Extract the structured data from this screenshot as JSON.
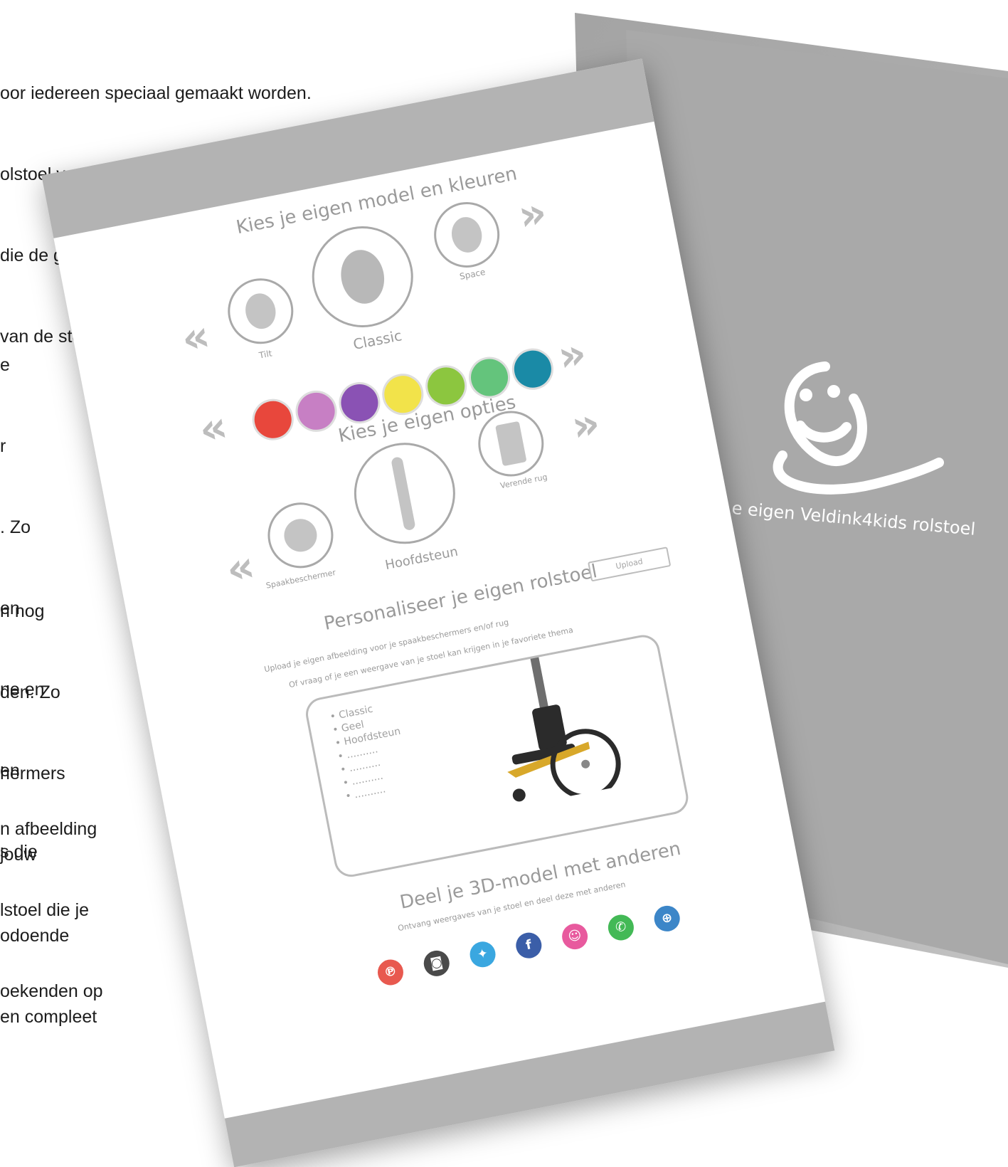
{
  "background_text": {
    "top_lines": [
      "oor iedereen speciaal gemaakt worden.",
      "olstoel van alle functionaliteiten",
      "die de gebruiker nodig heeft.",
      "van de stoel is"
    ],
    "mid_lines": [
      "e",
      "r",
      ". Zo",
      "en",
      "ne en",
      "en",
      "s die"
    ],
    "mid2_lines": [
      "n nog",
      "den. Zo",
      "hermers",
      "jouw",
      "odoende",
      "en compleet"
    ],
    "bottom_lines": [
      "n afbeelding",
      "lstoel die je",
      "oekenden op"
    ]
  },
  "back_card": {
    "tagline": "e eigen Veldink4kids rolstoel"
  },
  "front_page": {
    "section_model_title": "Kies je eigen model en kleuren",
    "models": [
      {
        "label": "Tilt",
        "icon": "wheelchair-tilt-icon"
      },
      {
        "label": "Classic",
        "icon": "wheelchair-classic-icon"
      },
      {
        "label": "Space",
        "icon": "wheelchair-space-icon"
      }
    ],
    "colors": [
      "#e8473c",
      "#c77fc4",
      "#8a52b4",
      "#f2e34a",
      "#8cc63f",
      "#64c47c",
      "#1a8aa6"
    ],
    "section_options_title": "Kies je eigen opties",
    "options": [
      {
        "label": "Spaakbeschermer",
        "icon": "spoke-guard-icon"
      },
      {
        "label": "Hoofdsteun",
        "icon": "headrest-icon"
      },
      {
        "label": "Verende rug",
        "icon": "spring-back-icon"
      }
    ],
    "section_personalise_title": "Personaliseer je eigen rolstoel",
    "upload_button": "Upload",
    "personalise_line1": "Upload je eigen afbeelding voor je spaakbeschermers en/of rug",
    "personalise_line2": "Of vraag of je een weergave van je stoel kan krijgen in je favoriete thema",
    "summary_items": [
      "Classic",
      "Geel",
      "Hoofdsteun",
      "..........",
      "..........",
      "..........",
      ".........."
    ],
    "section_share_title": "Deel je 3D-model met anderen",
    "share_subtitle": "Ontvang weergaves van je stoel en deel deze met anderen",
    "social": [
      {
        "name": "pinterest-icon",
        "glyph": "℗",
        "color": "#e8594f"
      },
      {
        "name": "instagram-icon",
        "glyph": "◙",
        "color": "#4a4a4a"
      },
      {
        "name": "twitter-icon",
        "glyph": "✦",
        "color": "#3aa7e0"
      },
      {
        "name": "facebook-icon",
        "glyph": "f",
        "color": "#3b5ea8"
      },
      {
        "name": "veldink-icon",
        "glyph": "☺",
        "color": "#e85a9e"
      },
      {
        "name": "whatsapp-icon",
        "glyph": "✆",
        "color": "#43b956"
      },
      {
        "name": "globe-icon",
        "glyph": "⊕",
        "color": "#3c86c8"
      }
    ]
  }
}
